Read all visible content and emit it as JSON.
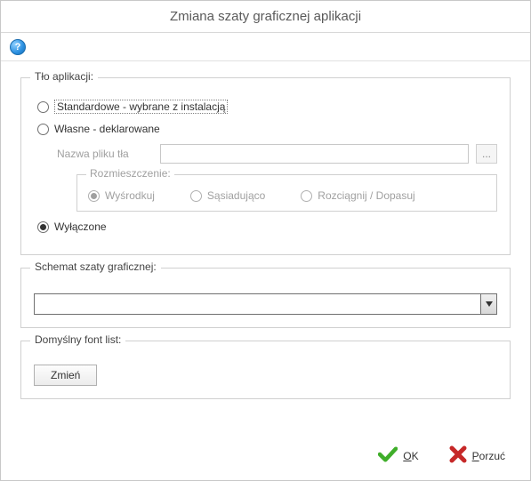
{
  "window": {
    "title": "Zmiana szaty graficznej aplikacji"
  },
  "toolbar": {
    "help_glyph": "?"
  },
  "background_group": {
    "legend": "Tło aplikacji:",
    "opt_standard": "Standardowe - wybrane z instalacją",
    "opt_custom": "Własne - deklarowane",
    "file_label": "Nazwa pliku tła",
    "file_value": "",
    "browse_label": "...",
    "placement_legend": "Rozmieszczenie:",
    "placement_center": "Wyśrodkuj",
    "placement_tile": "Sąsiadująco",
    "placement_stretch": "Rozciągnij / Dopasuj",
    "opt_off": "Wyłączone"
  },
  "scheme_group": {
    "legend": "Schemat szaty graficznej:",
    "value": ""
  },
  "font_group": {
    "legend": "Domyślny font list:",
    "change_btn": "Zmień"
  },
  "footer": {
    "ok_prefix": "O",
    "ok_rest": "K",
    "cancel_prefix": "P",
    "cancel_rest": "orzuć"
  }
}
